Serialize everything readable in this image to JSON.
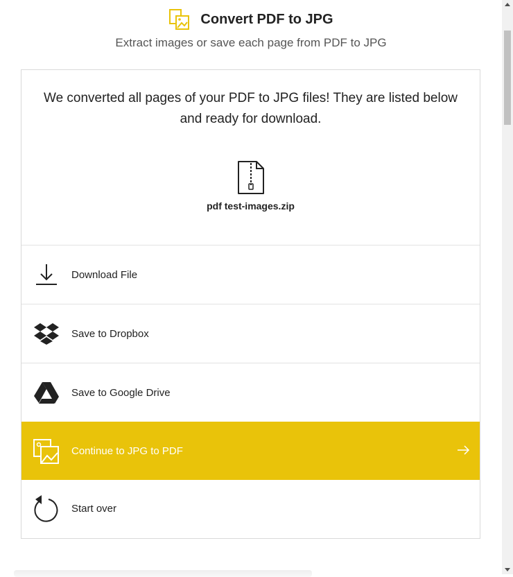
{
  "header": {
    "title": "Convert PDF to JPG",
    "subtitle": "Extract images or save each page from PDF to JPG"
  },
  "result": {
    "message": "We converted all pages of your PDF to JPG files! They are listed below and ready for download.",
    "file_name": "pdf test-images.zip",
    "file_icon": "zip-file-icon"
  },
  "actions": [
    {
      "label": "Download File",
      "icon": "download-icon"
    },
    {
      "label": "Save to Dropbox",
      "icon": "dropbox-icon"
    },
    {
      "label": "Save to Google Drive",
      "icon": "google-drive-icon"
    },
    {
      "label": "Continue to JPG to PDF",
      "icon": "images-icon"
    },
    {
      "label": "Start over",
      "icon": "restart-icon"
    }
  ],
  "colors": {
    "accent": "#e9c30a",
    "border": "#d9d9d9",
    "text": "#222222"
  }
}
